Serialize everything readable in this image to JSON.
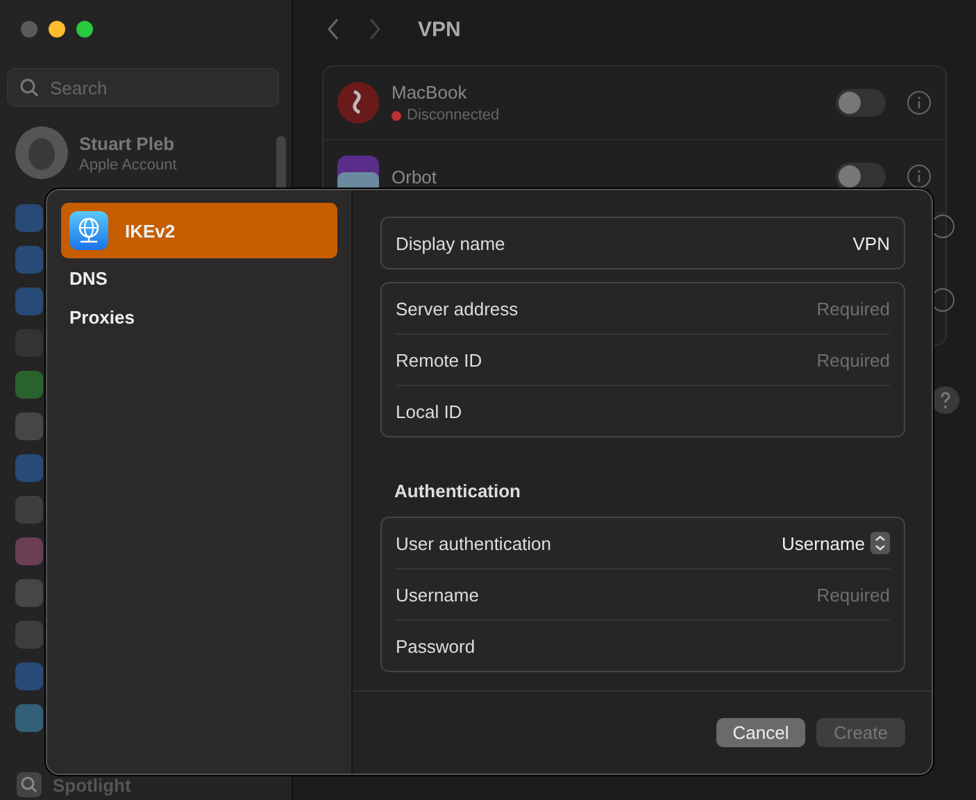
{
  "window": {
    "search": {
      "placeholder": "Search"
    },
    "account": {
      "name": "Stuart Pleb",
      "subtitle": "Apple Account"
    },
    "sidebar_items": [
      {
        "label": "Spotlight"
      }
    ]
  },
  "page": {
    "title": "VPN",
    "vpns": [
      {
        "name": "MacBook",
        "status": "Disconnected",
        "on": false
      },
      {
        "name": "Orbot",
        "on": false
      }
    ]
  },
  "dialog": {
    "sidebar": [
      {
        "label": "IKEv2",
        "selected": true
      },
      {
        "label": "DNS",
        "selected": false
      },
      {
        "label": "Proxies",
        "selected": false
      }
    ],
    "groups": [
      {
        "rows": [
          {
            "kind": "field",
            "label": "Display name",
            "value": "VPN"
          }
        ]
      },
      {
        "rows": [
          {
            "kind": "field",
            "label": "Server address",
            "placeholder": "Required"
          },
          {
            "kind": "field",
            "label": "Remote ID",
            "placeholder": "Required"
          },
          {
            "kind": "field",
            "label": "Local ID"
          }
        ]
      },
      {
        "title": "Authentication",
        "rows": [
          {
            "kind": "popup",
            "label": "User authentication",
            "value": "Username"
          },
          {
            "kind": "field",
            "label": "Username",
            "placeholder": "Required"
          },
          {
            "kind": "field",
            "label": "Password"
          }
        ]
      }
    ],
    "buttons": [
      {
        "label": "Cancel",
        "disabled": false
      },
      {
        "label": "Create",
        "disabled": true
      }
    ]
  }
}
